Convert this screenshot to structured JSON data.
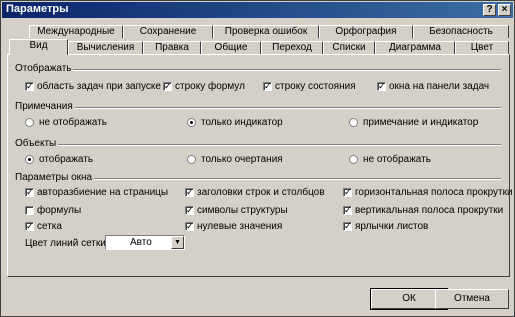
{
  "window": {
    "title": "Параметры"
  },
  "titlebar": {
    "help": "?",
    "close": "×"
  },
  "tabs_row1": [
    {
      "label": "Международные"
    },
    {
      "label": "Сохранение"
    },
    {
      "label": "Проверка ошибок"
    },
    {
      "label": "Орфография"
    },
    {
      "label": "Безопасность"
    }
  ],
  "tabs_row2": [
    {
      "label": "Вид",
      "active": true
    },
    {
      "label": "Вычисления"
    },
    {
      "label": "Правка"
    },
    {
      "label": "Общие"
    },
    {
      "label": "Переход"
    },
    {
      "label": "Списки"
    },
    {
      "label": "Диаграмма"
    },
    {
      "label": "Цвет"
    }
  ],
  "display": {
    "label": "Отображать",
    "items": [
      {
        "label": "область задач при запуске",
        "checked": true
      },
      {
        "label": "строку формул",
        "checked": true
      },
      {
        "label": "строку состояния",
        "checked": true
      },
      {
        "label": "окна на панели задач",
        "checked": true
      }
    ]
  },
  "comments": {
    "label": "Примечания",
    "options": [
      {
        "label": "не отображать",
        "selected": false
      },
      {
        "label": "только индикатор",
        "selected": true
      },
      {
        "label": "примечание и индикатор",
        "selected": false
      }
    ]
  },
  "objects": {
    "label": "Объекты",
    "options": [
      {
        "label": "отображать",
        "selected": true
      },
      {
        "label": "только очертания",
        "selected": false
      },
      {
        "label": "не отображать",
        "selected": false
      }
    ]
  },
  "window_params": {
    "label": "Параметры окна",
    "items": [
      {
        "label": "авторазбиение на страницы",
        "checked": true
      },
      {
        "label": "заголовки строк и столбцов",
        "checked": true
      },
      {
        "label": "горизонтальная полоса прокрутки",
        "checked": true
      },
      {
        "label": "формулы",
        "checked": false
      },
      {
        "label": "символы структуры",
        "checked": true
      },
      {
        "label": "вертикальная полоса прокрутки",
        "checked": true
      },
      {
        "label": "сетка",
        "checked": true
      },
      {
        "label": "нулевые значения",
        "checked": true
      },
      {
        "label": "ярлычки листов",
        "checked": true
      }
    ],
    "gridline_color_label": "Цвет линий сетки:",
    "gridline_color_value": "Авто"
  },
  "buttons": {
    "ok": "ОК",
    "cancel": "Отмена"
  },
  "check_mark": "✓"
}
